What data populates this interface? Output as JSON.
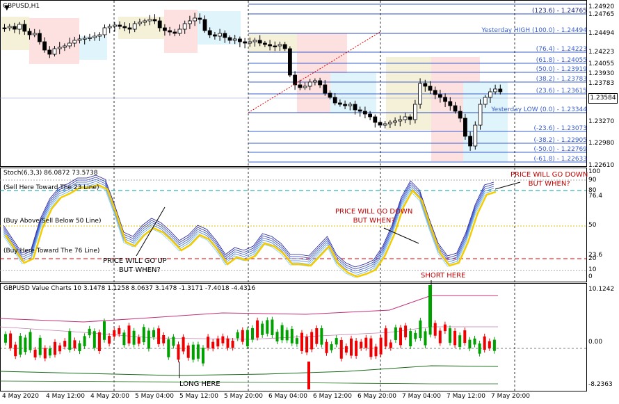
{
  "window": {
    "symbol_title": "GBPUSD,H1"
  },
  "price_axis": [
    "1.24920",
    "1.24765",
    "1.24494",
    "1.24223",
    "1.24055",
    "1.23930",
    "1.23783",
    "1.23584",
    "1.23270",
    "1.22980",
    "1.22610"
  ],
  "current_price": "1.23584",
  "fib_levels": [
    {
      "label": "(123.6) - 1.24765"
    },
    {
      "label": "Yesterday HIGH (100.0) - 1.24494"
    },
    {
      "label": "(76.4) - 1.24223"
    },
    {
      "label": "(61.8) - 1.24055"
    },
    {
      "label": "(50.0) - 1.23919"
    },
    {
      "label": "(38.2) - 1.23783"
    },
    {
      "label": "(23.6) - 1.23615"
    },
    {
      "label": "Yesterday LOW (0.0) - 1.23344"
    },
    {
      "label": "(-23.6) - 1.23073"
    },
    {
      "label": "(-38.2) - 1.22905"
    },
    {
      "label": "(-50.0) - 1.22769"
    },
    {
      "label": "(-61.8) - 1.22633"
    }
  ],
  "stoch": {
    "title": "Stoch(6,3,3) 86.0872 73.5738",
    "levels_text": [
      "(Sell Here Toward The 23 Line)",
      "(Buy Above/Sell Below 50 Line)",
      "(Buy Here Toward The 76 Line)"
    ],
    "axis": [
      "100",
      "90",
      "80",
      "76.4",
      "50",
      "23.6",
      "20",
      "10",
      "0"
    ],
    "annotations": {
      "go_up": [
        "PRICE WILL GO UP",
        "BUT WHEN?"
      ],
      "go_down_mid": [
        "PRICE WILL GO DOWN",
        "BUT WHEN?"
      ],
      "go_down_right": [
        "PRICE WILL GO DOWN",
        "BUT WHEN?"
      ]
    }
  },
  "value_chart": {
    "title": "GBPUSD Value Charts 10 3.1478 1.1258 8.0637 3.1478 -1.3171 -7.4018 -4.4316",
    "axis": [
      "10.1242",
      "0.00",
      "-8.2363"
    ],
    "short_label": "SHORT HERE",
    "long_label": "LONG HERE"
  },
  "time_axis": [
    "4 May 2020",
    "4 May 12:00",
    "4 May 20:00",
    "5 May 04:00",
    "5 May 12:00",
    "5 May 20:00",
    "6 May 04:00",
    "6 May 12:00",
    "6 May 20:00",
    "7 May 04:00",
    "7 May 12:00",
    "7 May 20:00"
  ],
  "colors": {
    "bull": "#00a000",
    "bear": "#ee0000",
    "stoch_main": "#f5cc00",
    "fib": "#3a5fcd",
    "annotation": "#c00000"
  }
}
